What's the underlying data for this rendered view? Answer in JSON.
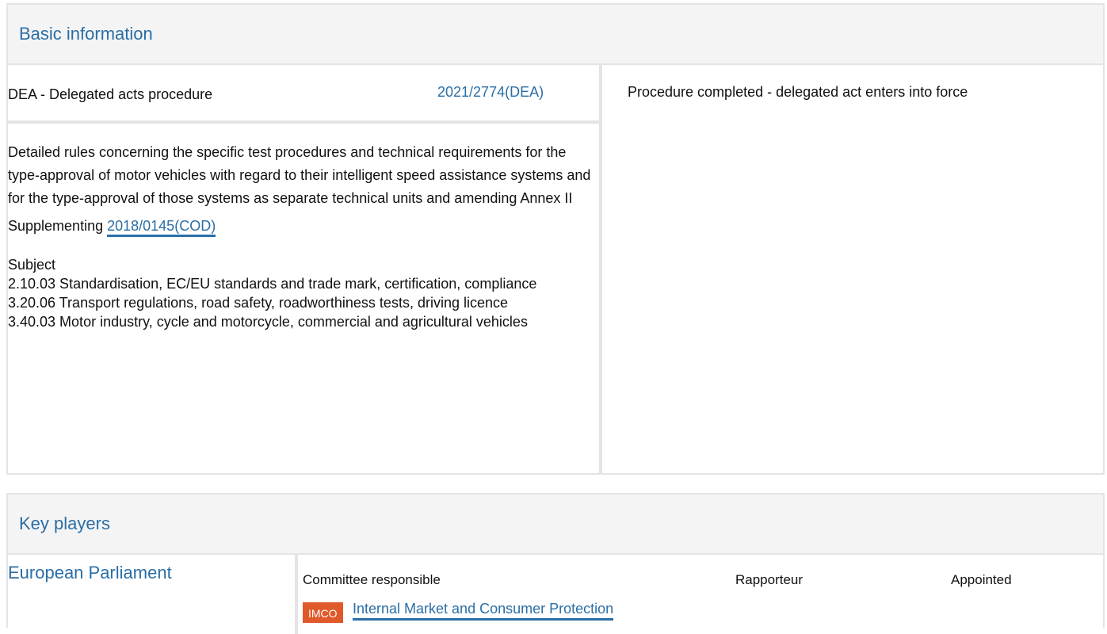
{
  "basic_info": {
    "header": "Basic information",
    "procedure_type": "DEA - Delegated acts procedure",
    "procedure_ref": "2021/2774(DEA)",
    "status": "Procedure completed - delegated act enters into force",
    "description": "Detailed rules concerning the specific test procedures and technical requirements for the type-approval of motor vehicles with regard to their intelligent speed assistance systems and for the type-approval of those systems as separate technical units and amending Annex II",
    "supplementing_label": "Supplementing",
    "supplementing_ref": "2018/0145(COD)",
    "subject_label": "Subject",
    "subjects": [
      "2.10.03 Standardisation, EC/EU standards and trade mark, certification, compliance",
      "3.20.06 Transport regulations, road safety, roadworthiness tests, driving licence",
      "3.40.03 Motor industry, cycle and motorcycle, commercial and agricultural vehicles"
    ]
  },
  "key_players": {
    "header": "Key players",
    "institution": "European Parliament",
    "columns": {
      "committee": "Committee responsible",
      "rapporteur": "Rapporteur",
      "appointed": "Appointed"
    },
    "committee_badge": "IMCO",
    "committee_name": "Internal Market and Consumer Protection",
    "badge_color": "#e0592a"
  },
  "colors": {
    "link": "#2a6ea6",
    "border": "#e4e4e4",
    "header_bg": "#f4f4f4"
  }
}
